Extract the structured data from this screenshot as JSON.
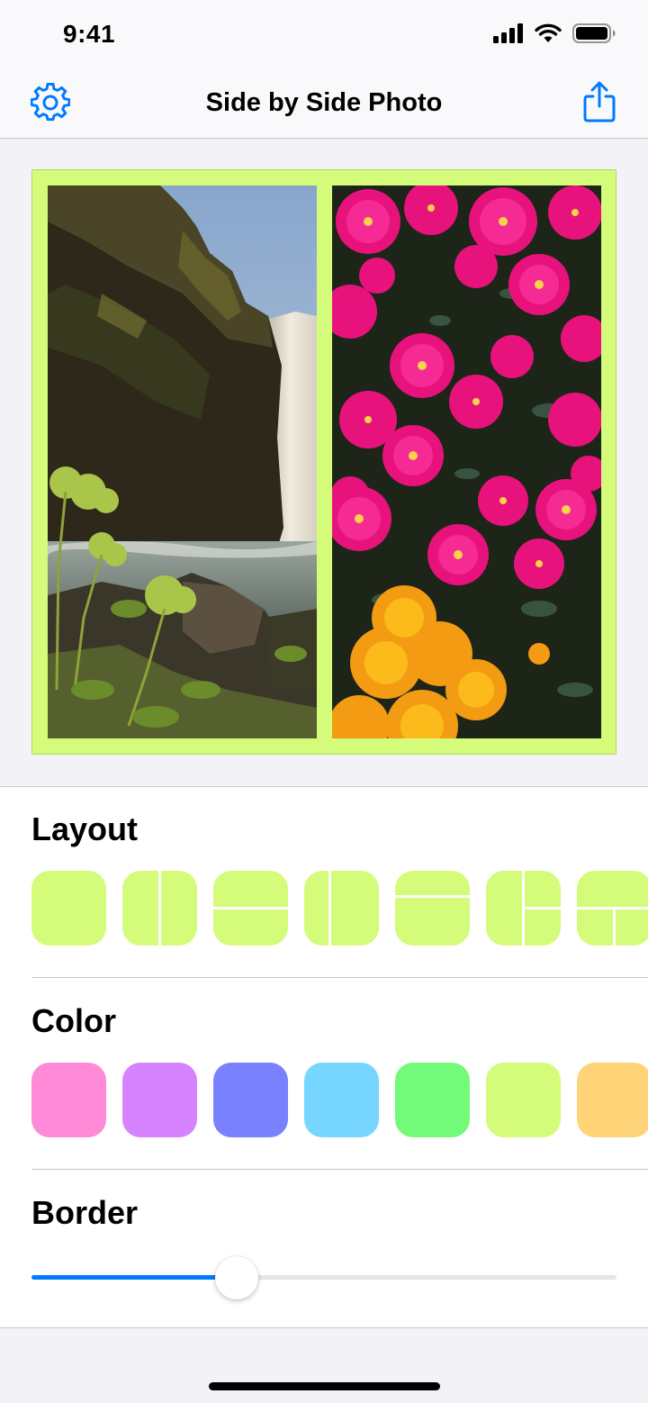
{
  "status_bar": {
    "time": "9:41"
  },
  "nav": {
    "title": "Side by Side Photo"
  },
  "sections": {
    "layout_title": "Layout",
    "color_title": "Color",
    "border_title": "Border"
  },
  "layouts": [
    "single",
    "two-columns",
    "two-rows",
    "narrow-wide-columns",
    "short-tall-rows",
    "column-and-split",
    "row-and-split"
  ],
  "colors": [
    "#ff8ad8",
    "#d783ff",
    "#7a81ff",
    "#76d6ff",
    "#73fa79",
    "#d4fb79",
    "#ffd479"
  ],
  "selected_color": "#d4fb79",
  "border_value": 0.35,
  "icons": {
    "settings": "gear-icon",
    "share": "share-icon"
  }
}
